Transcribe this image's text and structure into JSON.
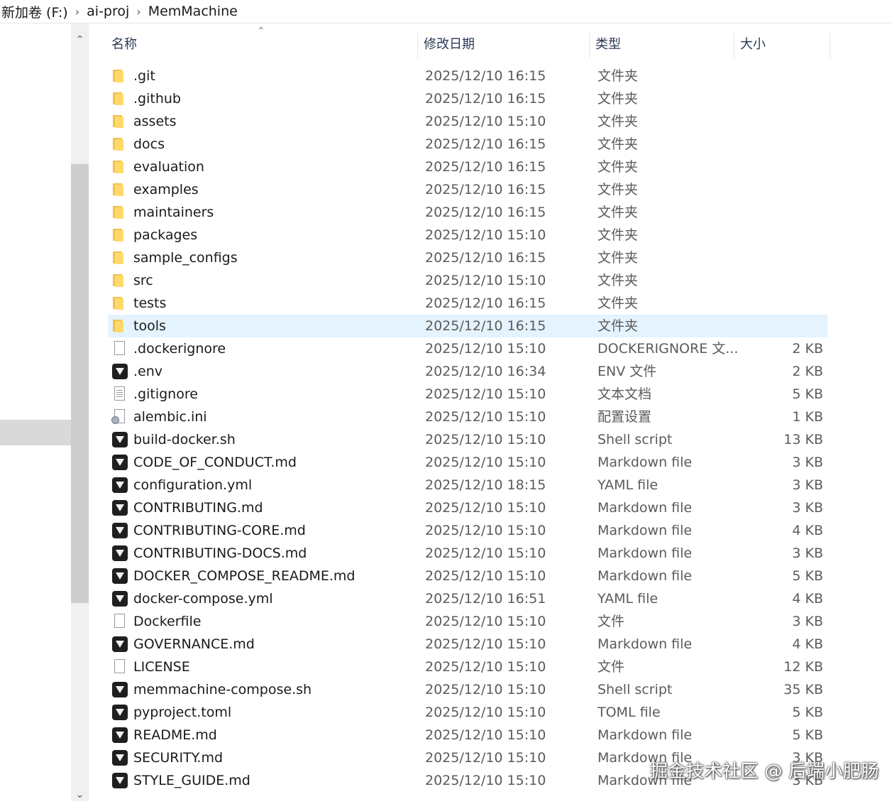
{
  "breadcrumb": {
    "items": [
      "新加卷 (F:)",
      "ai-proj",
      "MemMachine"
    ],
    "separator": "›"
  },
  "header": {
    "name": "名称",
    "date": "修改日期",
    "type": "类型",
    "size": "大小"
  },
  "files": [
    {
      "name": ".git",
      "date": "2025/12/10 16:15",
      "type": "文件夹",
      "size": "",
      "icon": "folder-icon"
    },
    {
      "name": ".github",
      "date": "2025/12/10 16:15",
      "type": "文件夹",
      "size": "",
      "icon": "folder-icon"
    },
    {
      "name": "assets",
      "date": "2025/12/10 15:10",
      "type": "文件夹",
      "size": "",
      "icon": "folder-icon"
    },
    {
      "name": "docs",
      "date": "2025/12/10 16:15",
      "type": "文件夹",
      "size": "",
      "icon": "folder-icon"
    },
    {
      "name": "evaluation",
      "date": "2025/12/10 16:15",
      "type": "文件夹",
      "size": "",
      "icon": "folder-icon"
    },
    {
      "name": "examples",
      "date": "2025/12/10 16:15",
      "type": "文件夹",
      "size": "",
      "icon": "folder-icon"
    },
    {
      "name": "maintainers",
      "date": "2025/12/10 16:15",
      "type": "文件夹",
      "size": "",
      "icon": "folder-icon"
    },
    {
      "name": "packages",
      "date": "2025/12/10 15:10",
      "type": "文件夹",
      "size": "",
      "icon": "folder-icon"
    },
    {
      "name": "sample_configs",
      "date": "2025/12/10 16:15",
      "type": "文件夹",
      "size": "",
      "icon": "folder-icon"
    },
    {
      "name": "src",
      "date": "2025/12/10 15:10",
      "type": "文件夹",
      "size": "",
      "icon": "folder-icon"
    },
    {
      "name": "tests",
      "date": "2025/12/10 16:15",
      "type": "文件夹",
      "size": "",
      "icon": "folder-icon"
    },
    {
      "name": "tools",
      "date": "2025/12/10 16:15",
      "type": "文件夹",
      "size": "",
      "icon": "folder-icon",
      "selected": true
    },
    {
      "name": ".dockerignore",
      "date": "2025/12/10 15:10",
      "type": "DOCKERIGNORE 文...",
      "size": "2 KB",
      "icon": "blank-file-icon"
    },
    {
      "name": ".env",
      "date": "2025/12/10 16:34",
      "type": "ENV 文件",
      "size": "2 KB",
      "icon": "app-file-icon"
    },
    {
      "name": ".gitignore",
      "date": "2025/12/10 15:10",
      "type": "文本文档",
      "size": "5 KB",
      "icon": "text-file-icon"
    },
    {
      "name": "alembic.ini",
      "date": "2025/12/10 15:10",
      "type": "配置设置",
      "size": "1 KB",
      "icon": "settings-file-icon"
    },
    {
      "name": "build-docker.sh",
      "date": "2025/12/10 15:10",
      "type": "Shell script",
      "size": "13 KB",
      "icon": "app-file-icon"
    },
    {
      "name": "CODE_OF_CONDUCT.md",
      "date": "2025/12/10 15:10",
      "type": "Markdown file",
      "size": "3 KB",
      "icon": "app-file-icon"
    },
    {
      "name": "configuration.yml",
      "date": "2025/12/10 18:15",
      "type": "YAML file",
      "size": "3 KB",
      "icon": "app-file-icon"
    },
    {
      "name": "CONTRIBUTING.md",
      "date": "2025/12/10 15:10",
      "type": "Markdown file",
      "size": "3 KB",
      "icon": "app-file-icon"
    },
    {
      "name": "CONTRIBUTING-CORE.md",
      "date": "2025/12/10 15:10",
      "type": "Markdown file",
      "size": "4 KB",
      "icon": "app-file-icon"
    },
    {
      "name": "CONTRIBUTING-DOCS.md",
      "date": "2025/12/10 15:10",
      "type": "Markdown file",
      "size": "3 KB",
      "icon": "app-file-icon"
    },
    {
      "name": "DOCKER_COMPOSE_README.md",
      "date": "2025/12/10 15:10",
      "type": "Markdown file",
      "size": "5 KB",
      "icon": "app-file-icon"
    },
    {
      "name": "docker-compose.yml",
      "date": "2025/12/10 16:51",
      "type": "YAML file",
      "size": "4 KB",
      "icon": "app-file-icon"
    },
    {
      "name": "Dockerfile",
      "date": "2025/12/10 15:10",
      "type": "文件",
      "size": "3 KB",
      "icon": "blank-file-icon"
    },
    {
      "name": "GOVERNANCE.md",
      "date": "2025/12/10 15:10",
      "type": "Markdown file",
      "size": "4 KB",
      "icon": "app-file-icon"
    },
    {
      "name": "LICENSE",
      "date": "2025/12/10 15:10",
      "type": "文件",
      "size": "12 KB",
      "icon": "blank-file-icon"
    },
    {
      "name": "memmachine-compose.sh",
      "date": "2025/12/10 15:10",
      "type": "Shell script",
      "size": "35 KB",
      "icon": "app-file-icon"
    },
    {
      "name": "pyproject.toml",
      "date": "2025/12/10 15:10",
      "type": "TOML file",
      "size": "5 KB",
      "icon": "app-file-icon"
    },
    {
      "name": "README.md",
      "date": "2025/12/10 15:10",
      "type": "Markdown file",
      "size": "5 KB",
      "icon": "app-file-icon"
    },
    {
      "name": "SECURITY.md",
      "date": "2025/12/10 15:10",
      "type": "Markdown file",
      "size": "3 KB",
      "icon": "app-file-icon"
    },
    {
      "name": "STYLE_GUIDE.md",
      "date": "2025/12/10 15:10",
      "type": "Markdown file",
      "size": "3 KB",
      "icon": "app-file-icon"
    }
  ],
  "watermark": "掘金技术社区 @ 后端小肥肠",
  "colors": {
    "selected_row": "#e5f3ff",
    "folder": "#ffd96a",
    "header_text": "#2b3a55"
  }
}
